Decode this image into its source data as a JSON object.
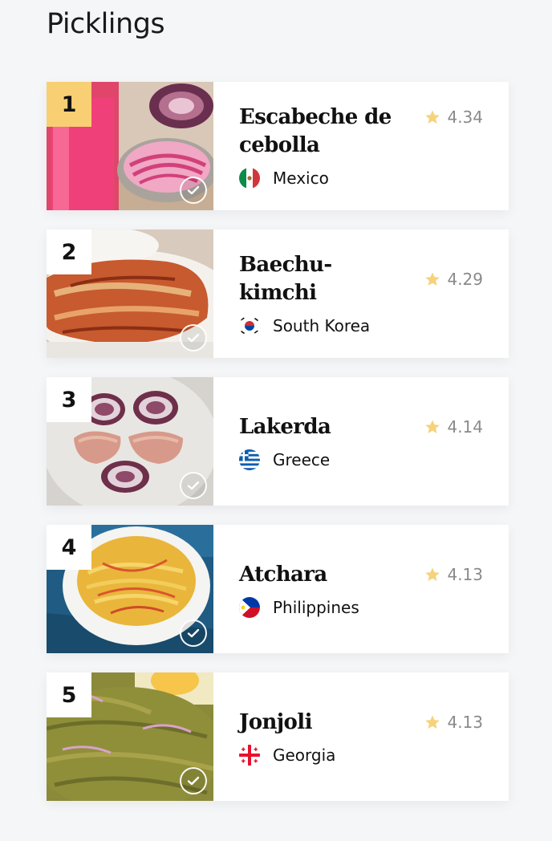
{
  "section": {
    "title": "Picklings"
  },
  "items": [
    {
      "rank": "1",
      "name": "Escabeche de cebolla",
      "country": "Mexico",
      "rating": "4.34",
      "flag_icon": "mexico-flag-icon",
      "image_icon": "pickled-red-onion-photo"
    },
    {
      "rank": "2",
      "name": "Baechu-kimchi",
      "country": "South Korea",
      "rating": "4.29",
      "flag_icon": "south-korea-flag-icon",
      "image_icon": "kimchi-photo"
    },
    {
      "rank": "3",
      "name": "Lakerda",
      "country": "Greece",
      "rating": "4.14",
      "flag_icon": "greece-flag-icon",
      "image_icon": "lakerda-fish-photo"
    },
    {
      "rank": "4",
      "name": "Atchara",
      "country": "Philippines",
      "rating": "4.13",
      "flag_icon": "philippines-flag-icon",
      "image_icon": "atchara-papaya-photo"
    },
    {
      "rank": "5",
      "name": "Jonjoli",
      "country": "Georgia",
      "rating": "4.13",
      "flag_icon": "georgia-flag-icon",
      "image_icon": "jonjoli-photo"
    }
  ],
  "colors": {
    "rank_gold": "#f9cf73",
    "star": "#f6d37a",
    "rating_text": "#8a8a8a",
    "page_bg": "#f5f6f8"
  }
}
